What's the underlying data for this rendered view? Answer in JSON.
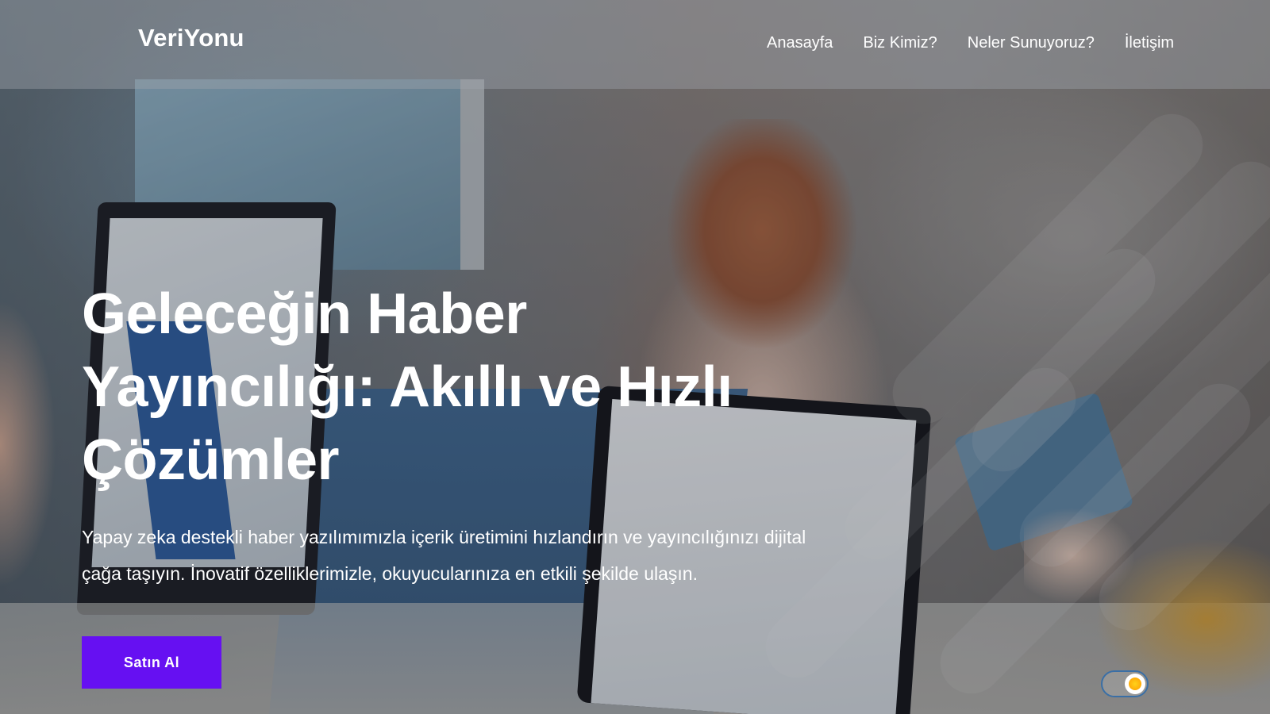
{
  "header": {
    "brand": "VeriYonu",
    "nav": [
      {
        "label": "Anasayfa"
      },
      {
        "label": "Biz Kimiz?"
      },
      {
        "label": "Neler Sunuyoruz?"
      },
      {
        "label": "İletişim"
      }
    ]
  },
  "hero": {
    "title": "Geleceğin Haber Yayıncılığı: Akıllı ve Hızlı Çözümler",
    "subtitle": "Yapay zeka destekli haber yazılımımızla içerik üretimini hızlandırın ve yayıncılığınızı dijital çağa taşıyın. İnovatif özelliklerimizle, okuyucularınıza en etkili şekilde ulaşın.",
    "cta_label": "Satın Al"
  },
  "theme_toggle": {
    "icon": "sun-icon",
    "state": "light"
  },
  "colors": {
    "accent": "#6610f2",
    "toggle_border": "#3a6fa6",
    "sun": "#ffb800"
  }
}
